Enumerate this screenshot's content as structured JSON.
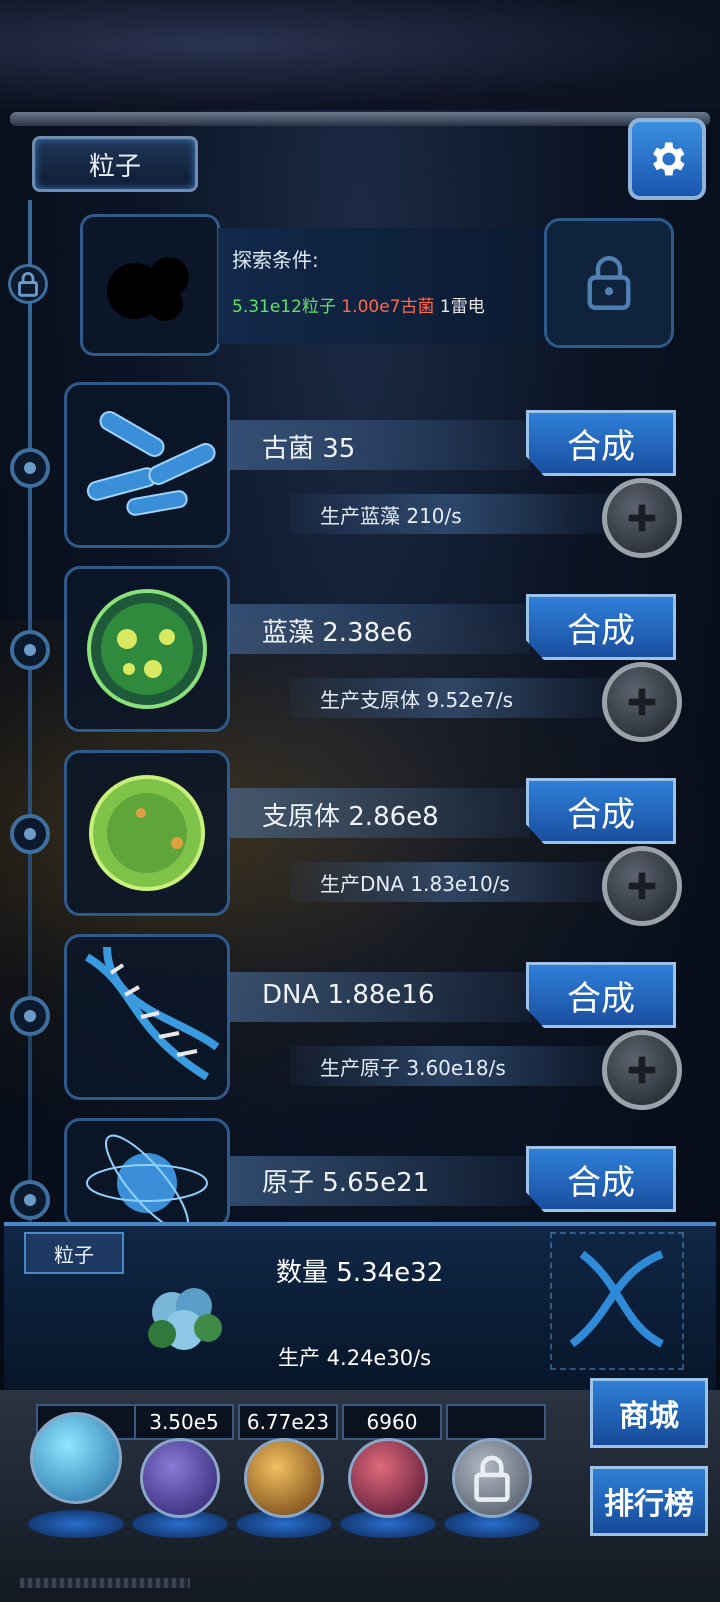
{
  "header": {
    "level_tab": "粒子"
  },
  "locked": {
    "condition_title": "探索条件:",
    "conditions": [
      {
        "text": "5.31e12粒子",
        "color": "#66e06a"
      },
      {
        "text": "1.00e7古菌",
        "color": "#ff6a4d"
      },
      {
        "text": "1雷电",
        "color": "#e8e8e8"
      }
    ]
  },
  "rows": [
    {
      "name": "古菌 35",
      "production": "生产蓝藻 210/s",
      "synth_label": "合成",
      "icon": "archaea-icon"
    },
    {
      "name": "蓝藻 2.38e6",
      "production": "生产支原体 9.52e7/s",
      "synth_label": "合成",
      "icon": "cyanobacteria-icon"
    },
    {
      "name": "支原体 2.86e8",
      "production": "生产DNA 1.83e10/s",
      "synth_label": "合成",
      "icon": "mycoplasma-icon"
    },
    {
      "name": "DNA 1.88e16",
      "production": "生产原子 3.60e18/s",
      "synth_label": "合成",
      "icon": "dna-icon"
    },
    {
      "name": "原子 5.65e21",
      "production": "",
      "synth_label": "合成",
      "icon": "atom-icon"
    }
  ],
  "panel": {
    "tag": "粒子",
    "quantity": "数量 5.34e32",
    "production": "生产 4.24e30/s"
  },
  "resources": [
    "",
    "3.50e5",
    "6.77e23",
    "6960",
    ""
  ],
  "buttons": {
    "shop": "商城",
    "rank": "排行榜"
  }
}
